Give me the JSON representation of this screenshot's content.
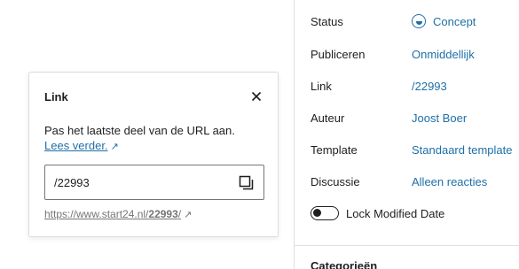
{
  "sidebar": {
    "rows": [
      {
        "label": "Status",
        "value": "Concept",
        "icon": "draft-status-icon"
      },
      {
        "label": "Publiceren",
        "value": "Onmiddellijk"
      },
      {
        "label": "Link",
        "value": "/22993"
      },
      {
        "label": "Auteur",
        "value": "Joost Boer"
      },
      {
        "label": "Template",
        "value": "Standaard template"
      },
      {
        "label": "Discussie",
        "value": "Alleen reacties"
      }
    ],
    "toggle": {
      "label": "Lock Modified Date",
      "checked": false
    },
    "next_section_title": "Categorieën"
  },
  "popover": {
    "title": "Link",
    "help_text": "Pas het laatste deel van de URL aan.",
    "help_link": "Lees verder.",
    "input_value": "/22993",
    "permalink_prefix": "https://www.start24.nl/",
    "permalink_slug": "22993",
    "permalink_suffix": "/"
  },
  "colors": {
    "accent": "#1e6fa8",
    "text": "#1e1e1e",
    "muted": "#757575",
    "border": "#e0e0e0"
  }
}
